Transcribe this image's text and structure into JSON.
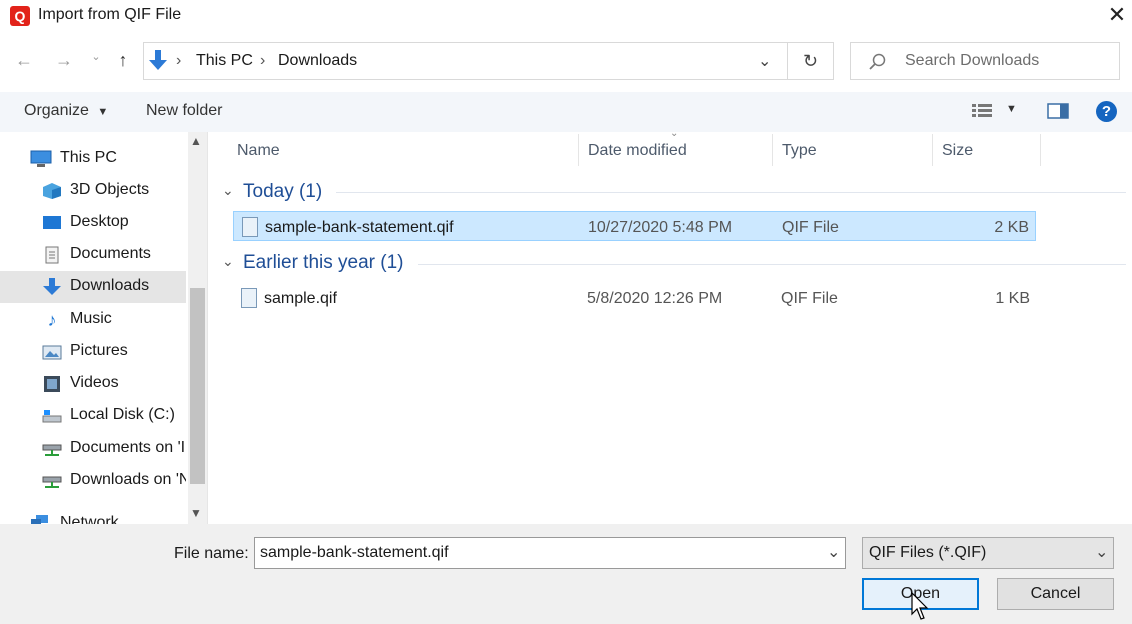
{
  "window": {
    "title": "Import from QIF File",
    "app_icon_letter": "Q",
    "brand_color": "#e2231a"
  },
  "address": {
    "crumbs": [
      "This PC",
      "Downloads"
    ]
  },
  "search": {
    "placeholder": "Search Downloads"
  },
  "toolbar": {
    "organize_label": "Organize",
    "new_folder_label": "New folder"
  },
  "sidebar": {
    "items": [
      {
        "label": "This PC",
        "icon": "computer-icon"
      },
      {
        "label": "3D Objects",
        "icon": "cube-icon"
      },
      {
        "label": "Desktop",
        "icon": "desktop-icon"
      },
      {
        "label": "Documents",
        "icon": "documents-icon"
      },
      {
        "label": "Downloads",
        "icon": "download-arrow-icon",
        "selected": true
      },
      {
        "label": "Music",
        "icon": "music-note-icon"
      },
      {
        "label": "Pictures",
        "icon": "pictures-icon"
      },
      {
        "label": "Videos",
        "icon": "video-icon"
      },
      {
        "label": "Local Disk (C:)",
        "icon": "disk-icon"
      },
      {
        "label": "Documents on 'I",
        "icon": "network-drive-icon"
      },
      {
        "label": "Downloads on 'N",
        "icon": "network-drive-icon"
      },
      {
        "label": "Network",
        "icon": "network-icon"
      }
    ]
  },
  "columns": {
    "name": "Name",
    "date": "Date modified",
    "type": "Type",
    "size": "Size"
  },
  "groups": [
    {
      "label": "Today (1)",
      "files": [
        {
          "name": "sample-bank-statement.qif",
          "date": "10/27/2020 5:48 PM",
          "type": "QIF File",
          "size": "2 KB",
          "selected": true
        }
      ]
    },
    {
      "label": "Earlier this year (1)",
      "files": [
        {
          "name": "sample.qif",
          "date": "5/8/2020 12:26 PM",
          "type": "QIF File",
          "size": "1 KB"
        }
      ]
    }
  ],
  "footer": {
    "file_name_label": "File name:",
    "file_name_value": "sample-bank-statement.qif",
    "filter_value": "QIF Files (*.QIF)",
    "open_label": "Open",
    "cancel_label": "Cancel"
  }
}
